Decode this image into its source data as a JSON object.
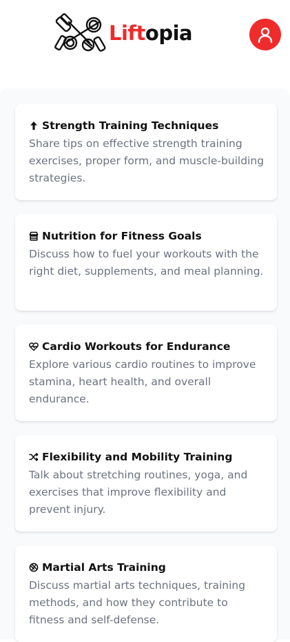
{
  "header": {
    "brand_part1": "Lift",
    "brand_part2": "opia",
    "logo_icon": "dumbbell-logo-icon",
    "profile_icon": "user-icon",
    "accent_color": "#ef2b2b"
  },
  "topics": [
    {
      "icon": "arrow-up-icon",
      "title": "Strength Training Techniques",
      "description": "Share tips on effective strength training exercises, proper form, and muscle-building strategies."
    },
    {
      "icon": "store-icon",
      "title": "Nutrition for Fitness Goals",
      "description": "Discuss how to fuel your workouts with the right diet, supplements, and meal planning."
    },
    {
      "icon": "heart-pulse-icon",
      "title": "Cardio Workouts for Endurance",
      "description": "Explore various cardio routines to improve stamina, heart health, and overall endurance."
    },
    {
      "icon": "shuffle-icon",
      "title": "Flexibility and Mobility Training",
      "description": "Talk about stretching routines, yoga, and exercises that improve flexibility and prevent injury."
    },
    {
      "icon": "martial-arts-icon",
      "title": "Martial Arts Training",
      "description": "Discuss martial arts techniques, training methods, and how they contribute to fitness and self-defense."
    }
  ]
}
